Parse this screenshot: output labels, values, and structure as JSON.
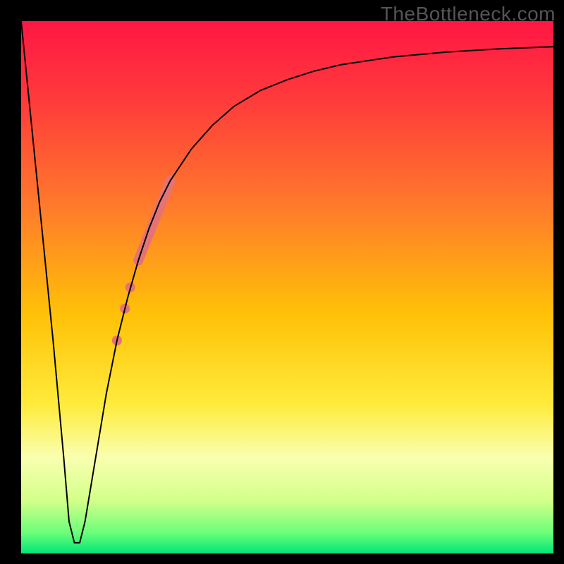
{
  "watermark": "TheBottleneck.com",
  "chart_data": {
    "type": "line",
    "title": "",
    "xlabel": "",
    "ylabel": "",
    "xlim": [
      0,
      100
    ],
    "ylim": [
      0,
      100
    ],
    "grid": false,
    "legend": false,
    "background_gradient": {
      "type": "vertical",
      "stops": [
        {
          "offset": 0.0,
          "color": "#ff1744"
        },
        {
          "offset": 0.15,
          "color": "#ff3b3b"
        },
        {
          "offset": 0.35,
          "color": "#ff7b2b"
        },
        {
          "offset": 0.55,
          "color": "#ffc107"
        },
        {
          "offset": 0.72,
          "color": "#ffeb3b"
        },
        {
          "offset": 0.82,
          "color": "#f9ffb0"
        },
        {
          "offset": 0.9,
          "color": "#d4ff8a"
        },
        {
          "offset": 0.96,
          "color": "#6eff7a"
        },
        {
          "offset": 1.0,
          "color": "#00e676"
        }
      ]
    },
    "series": [
      {
        "name": "bottleneck-curve",
        "stroke": "#000000",
        "stroke_width": 2,
        "x": [
          0,
          2,
          4,
          6,
          8,
          9,
          10,
          11,
          12,
          14,
          16,
          18,
          20,
          22,
          24,
          26,
          28,
          32,
          36,
          40,
          45,
          50,
          55,
          60,
          70,
          80,
          90,
          100
        ],
        "y": [
          100,
          80,
          60,
          40,
          18,
          6,
          2,
          2,
          6,
          18,
          30,
          40,
          48,
          55,
          61,
          66,
          70,
          76,
          80.5,
          84,
          87,
          89,
          90.6,
          91.8,
          93.3,
          94.2,
          94.8,
          95.2
        ]
      }
    ],
    "highlight_segment": {
      "name": "highlighted-range",
      "stroke": "#e57373",
      "stroke_width": 14,
      "x": [
        22,
        28
      ],
      "y": [
        55,
        70
      ]
    },
    "highlight_points": {
      "name": "highlight-dots",
      "fill": "#e57373",
      "radius": 7,
      "points": [
        {
          "x": 20.5,
          "y": 50
        },
        {
          "x": 19.5,
          "y": 46
        },
        {
          "x": 18.0,
          "y": 40
        }
      ]
    }
  }
}
